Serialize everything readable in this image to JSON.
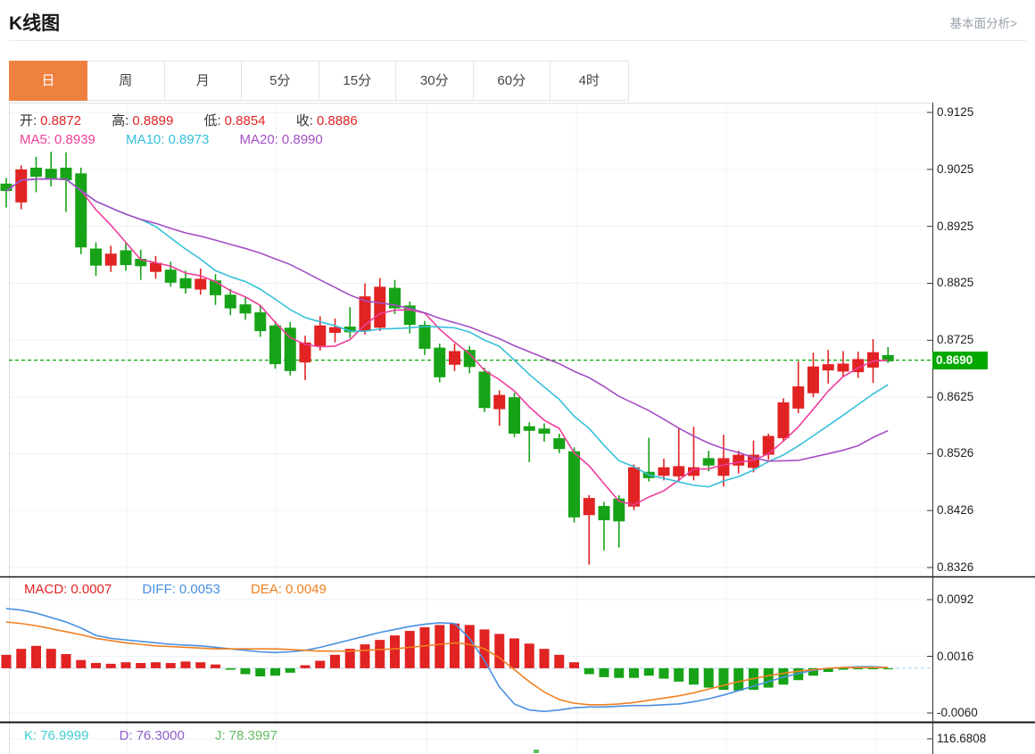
{
  "header": {
    "title": "K线图",
    "fundamental_link": "基本面分析>"
  },
  "tabs": {
    "items": [
      "日",
      "周",
      "月",
      "5分",
      "15分",
      "30分",
      "60分",
      "4时"
    ],
    "active_index": 0
  },
  "main_chart": {
    "ohlc": {
      "o_label": "开:",
      "o": "0.8872",
      "h_label": "高:",
      "h": "0.8899",
      "l_label": "低:",
      "l": "0.8854",
      "c_label": "收:",
      "c": "0.8886"
    },
    "ma": {
      "ma5_label": "MA5:",
      "ma5": "0.8939",
      "ma10_label": "MA10:",
      "ma10": "0.8973",
      "ma20_label": "MA20:",
      "ma20": "0.8990"
    },
    "current_price": "0.8690"
  },
  "macd_panel": {
    "macd_label": "MACD:",
    "macd": "0.0007",
    "diff_label": "DIFF:",
    "diff": "0.0053",
    "dea_label": "DEA:",
    "dea": "0.0049"
  },
  "kdj_panel": {
    "k_label": "K:",
    "k": "76.9999",
    "d_label": "D:",
    "d": "76.3000",
    "j_label": "J:",
    "j": "78.3997"
  },
  "colors": {
    "up": "#e12323",
    "down": "#17a317",
    "ma5": "#ef3d9a",
    "ma10": "#36c0da",
    "ma20": "#a44fc4",
    "diff": "#4a90e2",
    "dea": "#f08021",
    "kdj_j": "#63bd63",
    "price_line": "#00a800",
    "macd_zero_line": "#a9d3ef",
    "grid": "#edf1f7",
    "border": "#e0e0e0",
    "axis": "#333333",
    "separator": "#151515",
    "tab_active_bg": "#ef8140"
  },
  "chart_data": {
    "type": "candlestick",
    "title": "K线图",
    "interval": "日",
    "price_line": 0.869,
    "axis": {
      "main_ticks": [
        "0.9125",
        "0.9025",
        "0.8925",
        "0.8825",
        "0.8725",
        "0.8625",
        "0.8526",
        "0.8426",
        "0.8326"
      ],
      "main_ylim": [
        0.8326,
        0.9125
      ],
      "macd_ticks": [
        "0.0092",
        "0.0016",
        "-0.0060"
      ],
      "macd_ylim": [
        -0.006,
        0.0092
      ],
      "kdj_tick": "116.6808"
    },
    "ma_periods": [
      5,
      10,
      20
    ],
    "candles": [
      [
        0.9,
        0.901,
        0.8958,
        0.8987
      ],
      [
        0.8967,
        0.9032,
        0.8955,
        0.9025
      ],
      [
        0.9028,
        0.9047,
        0.8985,
        0.9012
      ],
      [
        0.9026,
        0.9056,
        0.8995,
        0.9009
      ],
      [
        0.9028,
        0.9055,
        0.895,
        0.9006
      ],
      [
        0.9018,
        0.9028,
        0.8876,
        0.8888
      ],
      [
        0.8886,
        0.8897,
        0.8838,
        0.8856
      ],
      [
        0.8856,
        0.8891,
        0.8845,
        0.8877
      ],
      [
        0.8883,
        0.8896,
        0.8847,
        0.8857
      ],
      [
        0.8868,
        0.8884,
        0.8831,
        0.8855
      ],
      [
        0.8845,
        0.8873,
        0.8833,
        0.8861
      ],
      [
        0.8849,
        0.8863,
        0.8819,
        0.8826
      ],
      [
        0.8834,
        0.8847,
        0.8807,
        0.8816
      ],
      [
        0.8814,
        0.8851,
        0.8805,
        0.8833
      ],
      [
        0.883,
        0.8841,
        0.8787,
        0.8804
      ],
      [
        0.8805,
        0.8815,
        0.8769,
        0.8781
      ],
      [
        0.8788,
        0.8801,
        0.8761,
        0.8772
      ],
      [
        0.8774,
        0.8785,
        0.8731,
        0.8741
      ],
      [
        0.8751,
        0.8759,
        0.8675,
        0.8683
      ],
      [
        0.8747,
        0.8757,
        0.8663,
        0.8671
      ],
      [
        0.8686,
        0.8733,
        0.8655,
        0.8721
      ],
      [
        0.8715,
        0.8767,
        0.8707,
        0.8751
      ],
      [
        0.8738,
        0.8763,
        0.8721,
        0.8748
      ],
      [
        0.8749,
        0.8783,
        0.8729,
        0.8739
      ],
      [
        0.8741,
        0.8825,
        0.8735,
        0.8802
      ],
      [
        0.8747,
        0.8834,
        0.8741,
        0.8819
      ],
      [
        0.8817,
        0.8831,
        0.8771,
        0.8781
      ],
      [
        0.8786,
        0.8793,
        0.8737,
        0.8752
      ],
      [
        0.8752,
        0.8759,
        0.8699,
        0.871
      ],
      [
        0.8712,
        0.8719,
        0.8651,
        0.866
      ],
      [
        0.8682,
        0.8719,
        0.8671,
        0.8706
      ],
      [
        0.8708,
        0.8715,
        0.8667,
        0.8678
      ],
      [
        0.867,
        0.8677,
        0.8599,
        0.8606
      ],
      [
        0.8604,
        0.8637,
        0.8575,
        0.8629
      ],
      [
        0.8625,
        0.8633,
        0.8555,
        0.8561
      ],
      [
        0.8574,
        0.8581,
        0.8511,
        0.8566
      ],
      [
        0.857,
        0.8579,
        0.8547,
        0.8561
      ],
      [
        0.8553,
        0.8561,
        0.8527,
        0.8534
      ],
      [
        0.853,
        0.8537,
        0.8405,
        0.8414
      ],
      [
        0.8418,
        0.8453,
        0.8331,
        0.8448
      ],
      [
        0.8434,
        0.8441,
        0.8356,
        0.8409
      ],
      [
        0.8447,
        0.8453,
        0.8361,
        0.8407
      ],
      [
        0.8433,
        0.8507,
        0.8427,
        0.8502
      ],
      [
        0.8494,
        0.8554,
        0.8477,
        0.8483
      ],
      [
        0.8487,
        0.8517,
        0.8479,
        0.8502
      ],
      [
        0.8486,
        0.8571,
        0.8477,
        0.8504
      ],
      [
        0.8487,
        0.8573,
        0.8479,
        0.8502
      ],
      [
        0.8518,
        0.8531,
        0.8495,
        0.8505
      ],
      [
        0.8487,
        0.8559,
        0.8468,
        0.8518
      ],
      [
        0.8505,
        0.8531,
        0.8491,
        0.8524
      ],
      [
        0.8501,
        0.8549,
        0.8493,
        0.8524
      ],
      [
        0.8524,
        0.8561,
        0.8515,
        0.8557
      ],
      [
        0.8553,
        0.8623,
        0.8547,
        0.8616
      ],
      [
        0.8605,
        0.8688,
        0.8597,
        0.8644
      ],
      [
        0.8632,
        0.8703,
        0.8625,
        0.8679
      ],
      [
        0.8672,
        0.8708,
        0.8649,
        0.8683
      ],
      [
        0.867,
        0.8706,
        0.8661,
        0.8684
      ],
      [
        0.8669,
        0.8705,
        0.8659,
        0.8692
      ],
      [
        0.8677,
        0.8727,
        0.865,
        0.8704
      ],
      [
        0.8699,
        0.8713,
        0.8685,
        0.8688
      ]
    ],
    "macd": {
      "hist": [
        0.0018,
        0.0026,
        0.003,
        0.0026,
        0.0019,
        0.0011,
        0.0007,
        0.0006,
        0.0008,
        0.0007,
        0.0008,
        0.0007,
        0.0009,
        0.0008,
        0.0005,
        -0.0002,
        -0.0008,
        -0.0011,
        -0.001,
        -0.0006,
        0.0004,
        0.001,
        0.0018,
        0.0026,
        0.0032,
        0.0038,
        0.0044,
        0.005,
        0.0055,
        0.0058,
        0.006,
        0.0058,
        0.0052,
        0.0046,
        0.004,
        0.0033,
        0.0026,
        0.0018,
        0.0008,
        -0.0008,
        -0.0012,
        -0.0013,
        -0.0013,
        -0.001,
        -0.0014,
        -0.0018,
        -0.0022,
        -0.0026,
        -0.0029,
        -0.003,
        -0.0029,
        -0.0026,
        -0.0022,
        -0.0016,
        -0.001,
        -0.0005,
        -0.0002,
        -0.0001,
        -0.0001,
        -0.0001
      ],
      "diff": [
        0.008,
        0.0078,
        0.0074,
        0.0068,
        0.0062,
        0.0054,
        0.0044,
        0.004,
        0.0038,
        0.0036,
        0.0034,
        0.0032,
        0.0031,
        0.003,
        0.0028,
        0.0026,
        0.0024,
        0.0022,
        0.0021,
        0.0022,
        0.0024,
        0.0028,
        0.0033,
        0.0038,
        0.0043,
        0.0048,
        0.0052,
        0.0056,
        0.0059,
        0.0061,
        0.006,
        0.004,
        0.001,
        -0.0025,
        -0.0048,
        -0.0056,
        -0.0058,
        -0.0056,
        -0.0053,
        -0.0052,
        -0.0052,
        -0.0051,
        -0.005,
        -0.005,
        -0.0049,
        -0.0048,
        -0.0045,
        -0.0041,
        -0.0036,
        -0.003,
        -0.0024,
        -0.0018,
        -0.0012,
        -0.0007,
        -0.0003,
        0.0,
        0.0001,
        0.0002,
        0.0002,
        0.0001
      ],
      "dea": [
        0.0062,
        0.006,
        0.0057,
        0.0053,
        0.0049,
        0.0045,
        0.004,
        0.0037,
        0.0034,
        0.0032,
        0.003,
        0.0029,
        0.0028,
        0.0027,
        0.0026,
        0.0026,
        0.0026,
        0.0026,
        0.0026,
        0.0025,
        0.0024,
        0.0023,
        0.0023,
        0.0023,
        0.0024,
        0.0025,
        0.0026,
        0.0028,
        0.003,
        0.0032,
        0.0034,
        0.0032,
        0.0026,
        0.0014,
        -0.0002,
        -0.0018,
        -0.0032,
        -0.0042,
        -0.0047,
        -0.0049,
        -0.0049,
        -0.0048,
        -0.0046,
        -0.0043,
        -0.004,
        -0.0037,
        -0.0033,
        -0.0028,
        -0.0023,
        -0.0018,
        -0.0014,
        -0.001,
        -0.0007,
        -0.0004,
        -0.0002,
        0.0,
        0.0001,
        0.0001,
        0.0001,
        0.0001
      ]
    }
  }
}
